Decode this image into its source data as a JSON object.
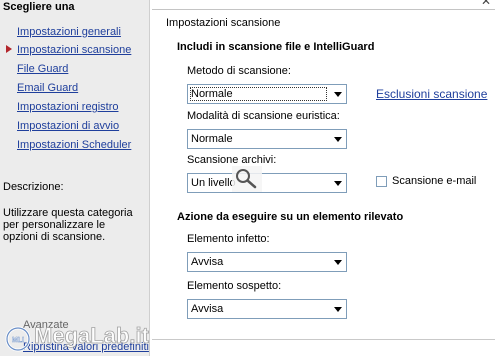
{
  "sidebar": {
    "title": "Scegliere una",
    "items": [
      {
        "label": "Impostazioni generali"
      },
      {
        "label": "Impostazioni scansione"
      },
      {
        "label": "File Guard"
      },
      {
        "label": "Email Guard"
      },
      {
        "label": "Impostazioni registro"
      },
      {
        "label": "Impostazioni di avvio"
      },
      {
        "label": "Impostazioni Scheduler"
      }
    ],
    "active_index": 1,
    "description_label": "Descrizione:",
    "description_text": "Utilizzare questa categoria per personalizzare le opzioni di scansione.",
    "advanced_label": "Avanzate",
    "default_link": "Ripristina valori predefiniti"
  },
  "main": {
    "section_title": "Impostazioni scansione",
    "include_title": "Includi in scansione file e IntelliGuard",
    "scan_method": {
      "label": "Metodo di scansione:",
      "value": "Normale"
    },
    "heuristic": {
      "label": "Modalità di scansione euristica:",
      "value": "Normale"
    },
    "archives": {
      "label": "Scansione archivi:",
      "value": "Un livello"
    },
    "exclusions_link": "Esclusioni scansione",
    "email_scan": {
      "label": "Scansione e-mail",
      "checked": false
    },
    "action_title": "Azione da eseguire su un elemento rilevato",
    "infected": {
      "label": "Elemento infetto:",
      "value": "Avvisa"
    },
    "suspicious": {
      "label": "Elemento sospetto:",
      "value": "Avvisa"
    }
  },
  "watermark": {
    "text": "MegaLab.it",
    "badge": "MLI"
  },
  "colors": {
    "link": "#1f3f9c",
    "marker": "#b3262c",
    "sidebar_bg": "#ececec",
    "combo_border": "#7f9db9"
  }
}
